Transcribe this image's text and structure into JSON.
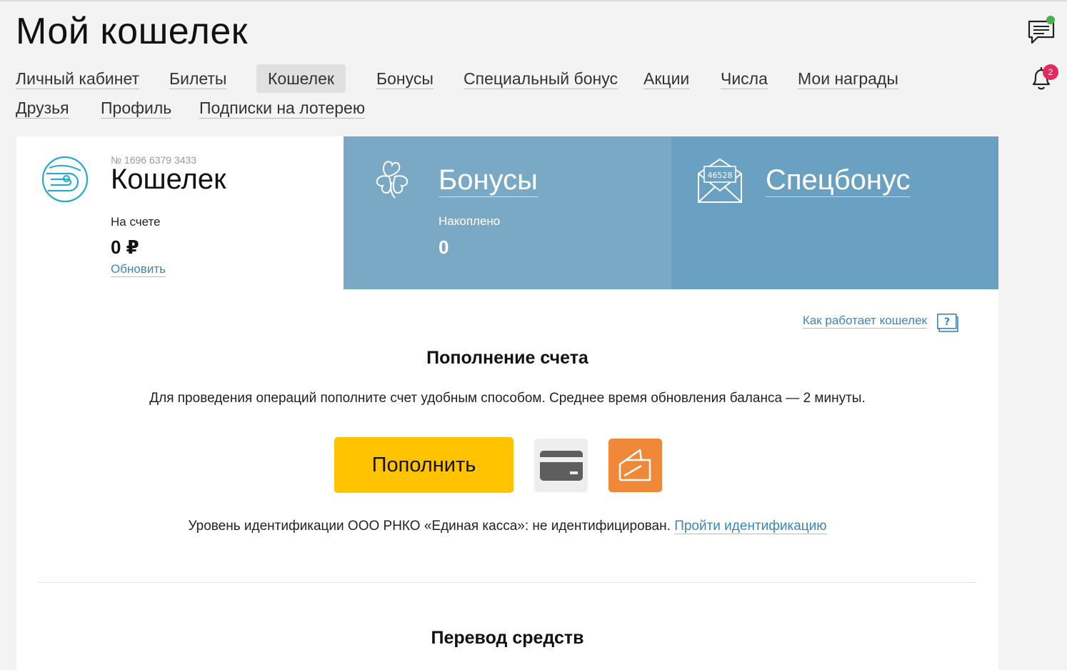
{
  "page": {
    "title": "Мой кошелек"
  },
  "header": {
    "notifications_count": "2",
    "chat_icon": "chat-icon",
    "bell_icon": "bell-icon"
  },
  "nav": {
    "items": [
      {
        "label": "Личный кабинет",
        "active": false
      },
      {
        "label": "Билеты",
        "active": false
      },
      {
        "label": "Кошелек",
        "active": true
      },
      {
        "label": "Бонусы",
        "active": false
      },
      {
        "label": "Специальный бонус",
        "active": false
      },
      {
        "label": "Акции",
        "active": false
      },
      {
        "label": "Числа",
        "active": false
      },
      {
        "label": "Мои награды",
        "active": false
      },
      {
        "label": "Друзья",
        "active": false
      },
      {
        "label": "Профиль",
        "active": false
      },
      {
        "label": "Подписки на лотерею",
        "active": false
      }
    ]
  },
  "wallet": {
    "number": "№ 1696 6379 3433",
    "title": "Кошелек",
    "balance_label": "На счете",
    "balance": "0 ₽",
    "refresh_label": "Обновить"
  },
  "bonus": {
    "title": "Бонусы",
    "label": "Накоплено",
    "value": "0"
  },
  "special": {
    "title": "Спецбонус",
    "ticket_number": "46528"
  },
  "help": {
    "link_label": "Как работает кошелек",
    "icon_label": "?"
  },
  "topup": {
    "title": "Пополнение счета",
    "description": "Для проведения операций пополните счет удобным способом. Среднее время обновления баланса — 2 минуты.",
    "button_label": "Пополнить"
  },
  "identification": {
    "text": "Уровень идентификации ООО РНКО «Единая касса»: не идентифицирован.",
    "link_label": "Пройти идентификацию"
  },
  "transfer": {
    "title": "Перевод средств"
  },
  "colors": {
    "accent": "#ffc300",
    "bonus_bg": "#7aa9c6",
    "special_bg": "#6aa0c1",
    "link": "#3a86bd",
    "wallet_method": "#f0883a"
  }
}
